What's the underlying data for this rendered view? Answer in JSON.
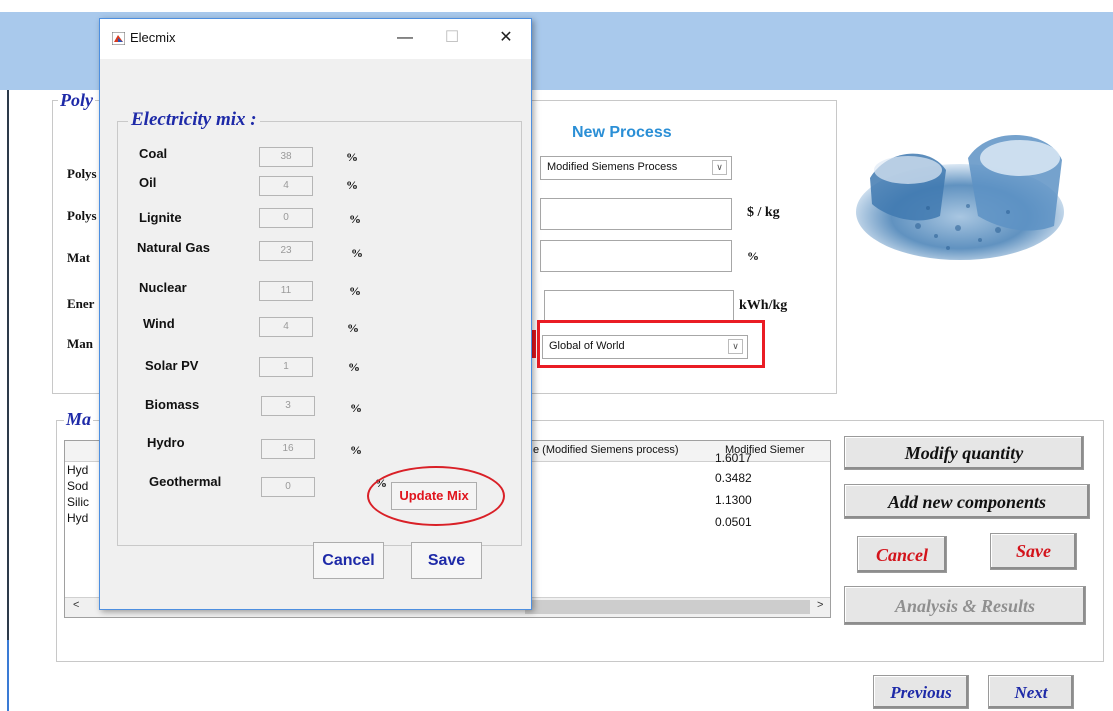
{
  "dialog": {
    "title": "Elecmix",
    "controls": {
      "minimize": "—",
      "maximize": "☐",
      "close": "✕"
    },
    "section_title": "Electricity mix :",
    "percent_sign": "%",
    "sources": [
      {
        "label": "Coal",
        "value": "38"
      },
      {
        "label": "Oil",
        "value": "4"
      },
      {
        "label": "Lignite",
        "value": "0"
      },
      {
        "label": "Natural Gas",
        "value": "23"
      },
      {
        "label": "Nuclear",
        "value": "11"
      },
      {
        "label": "Wind",
        "value": "4"
      },
      {
        "label": "Solar PV",
        "value": "1"
      },
      {
        "label": "Biomass",
        "value": "3"
      },
      {
        "label": "Hydro",
        "value": "16"
      },
      {
        "label": "Geothermal",
        "value": "0"
      }
    ],
    "update_button": "Update Mix",
    "cancel_button": "Cancel",
    "save_button": "Save"
  },
  "main": {
    "panel1_title": "Poly",
    "panel2_title": "Ma",
    "left_labels": [
      "Polys",
      "Polys",
      "Mat",
      "Ener",
      "Man"
    ],
    "new_process": {
      "title": "New Process",
      "process_select": "Modified Siemens Process",
      "unit_price": "$ / kg",
      "unit_percent": "%",
      "unit_energy": "kWh/kg",
      "region_select": "Global of World"
    },
    "table": {
      "header_col1": "e (Modified Siemens process)",
      "header_col2": "Modified Siemer",
      "rows": [
        {
          "name": "Hyd",
          "value": "1.6017"
        },
        {
          "name": "Sod",
          "value": "0.3482"
        },
        {
          "name": "Silic",
          "value": "1.1300"
        },
        {
          "name": "Hyd",
          "value": "0.0501"
        }
      ],
      "scroll_left": "<",
      "scroll_right": ">"
    },
    "buttons": {
      "modify": "Modify quantity",
      "add": "Add new components",
      "cancel": "Cancel",
      "save": "Save",
      "analysis": "Analysis & Results",
      "previous": "Previous",
      "next": "Next"
    }
  },
  "colors": {
    "accent_blue": "#1e2aa8",
    "accent_red": "#e0141d",
    "header_blue": "#a9c9ec",
    "process_title": "#2b8fd6"
  }
}
